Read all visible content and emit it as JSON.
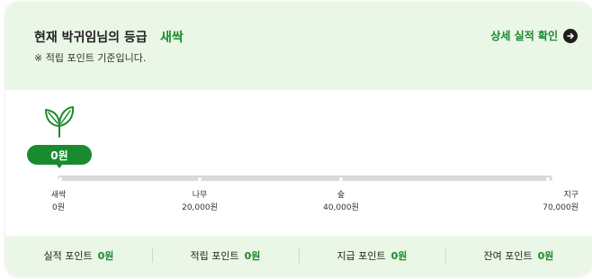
{
  "header": {
    "title": "현재 박귀임님의 등급",
    "grade": "새싹",
    "note": "※ 적립 포인트 기준입니다.",
    "detail_link": "상세 실적 확인",
    "link_icon": "arrow-right-circle-icon"
  },
  "progress": {
    "current_bubble": "0원",
    "current_value": 0,
    "max_value": 70000,
    "grade_icon": "sprout-icon",
    "levels": [
      {
        "name": "새싹",
        "threshold": "0원"
      },
      {
        "name": "나무",
        "threshold": "20,000원"
      },
      {
        "name": "숲",
        "threshold": "40,000원"
      },
      {
        "name": "지구",
        "threshold": "70,000원"
      }
    ]
  },
  "points": [
    {
      "label": "실적 포인트",
      "value": "0원"
    },
    {
      "label": "적립 포인트",
      "value": "0원"
    },
    {
      "label": "지급 포인트",
      "value": "0원"
    },
    {
      "label": "잔여 포인트",
      "value": "0원"
    }
  ],
  "colors": {
    "accent": "#1a8a2e",
    "header_bg": "#eaf6e6",
    "track": "#d9d9d9"
  }
}
